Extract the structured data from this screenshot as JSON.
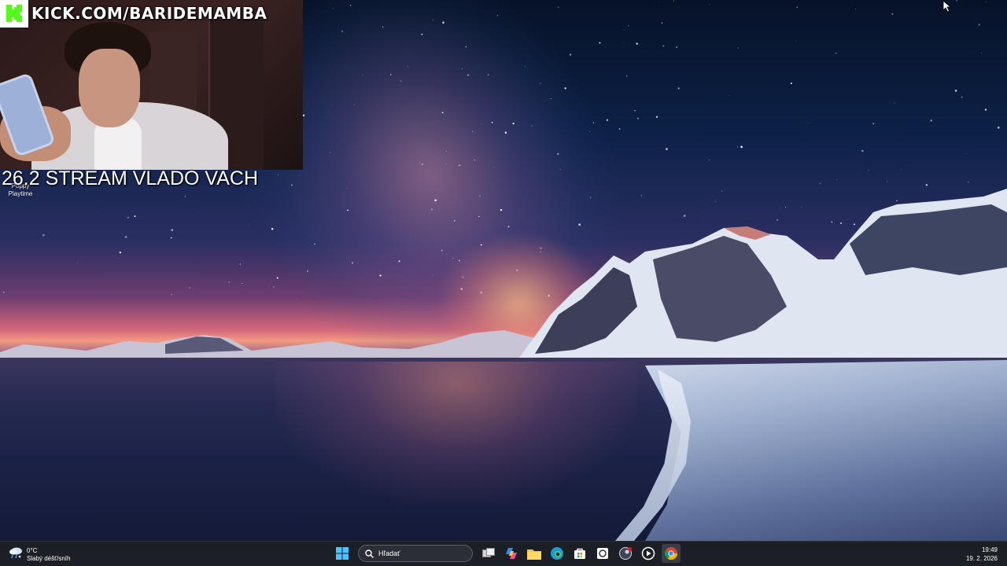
{
  "overlay": {
    "channel_url": "KICK.COM/BARIDEMAMBA",
    "stream_title": "26.2 STREAM VLADO VACH"
  },
  "desktop": {
    "icons": [
      {
        "label_line1": "Poppy",
        "label_line2": "Playtime",
        "icon": "poppy-playtime-icon"
      }
    ]
  },
  "taskbar": {
    "weather": {
      "temp": "0°C",
      "condition": "Slabý déšť/sníh",
      "icon": "weather-rain-snow-icon"
    },
    "search": {
      "placeholder": "Hľadať"
    },
    "apps": [
      {
        "name": "start",
        "icon": "windows-start-icon"
      },
      {
        "name": "task-view",
        "icon": "task-view-icon"
      },
      {
        "name": "copilot",
        "icon": "copilot-icon"
      },
      {
        "name": "file-explorer",
        "icon": "folder-icon"
      },
      {
        "name": "edge",
        "icon": "edge-icon"
      },
      {
        "name": "microsoft-store",
        "icon": "store-icon"
      },
      {
        "name": "obs",
        "icon": "obs-icon"
      },
      {
        "name": "steam",
        "icon": "steam-icon"
      },
      {
        "name": "media-player",
        "icon": "play-icon"
      },
      {
        "name": "chrome",
        "icon": "chrome-icon"
      }
    ],
    "clock": {
      "time": "19:49",
      "date": "19. 2. 2026"
    }
  },
  "colors": {
    "kick_green": "#53fc18",
    "taskbar_bg": "#1d1f26"
  }
}
